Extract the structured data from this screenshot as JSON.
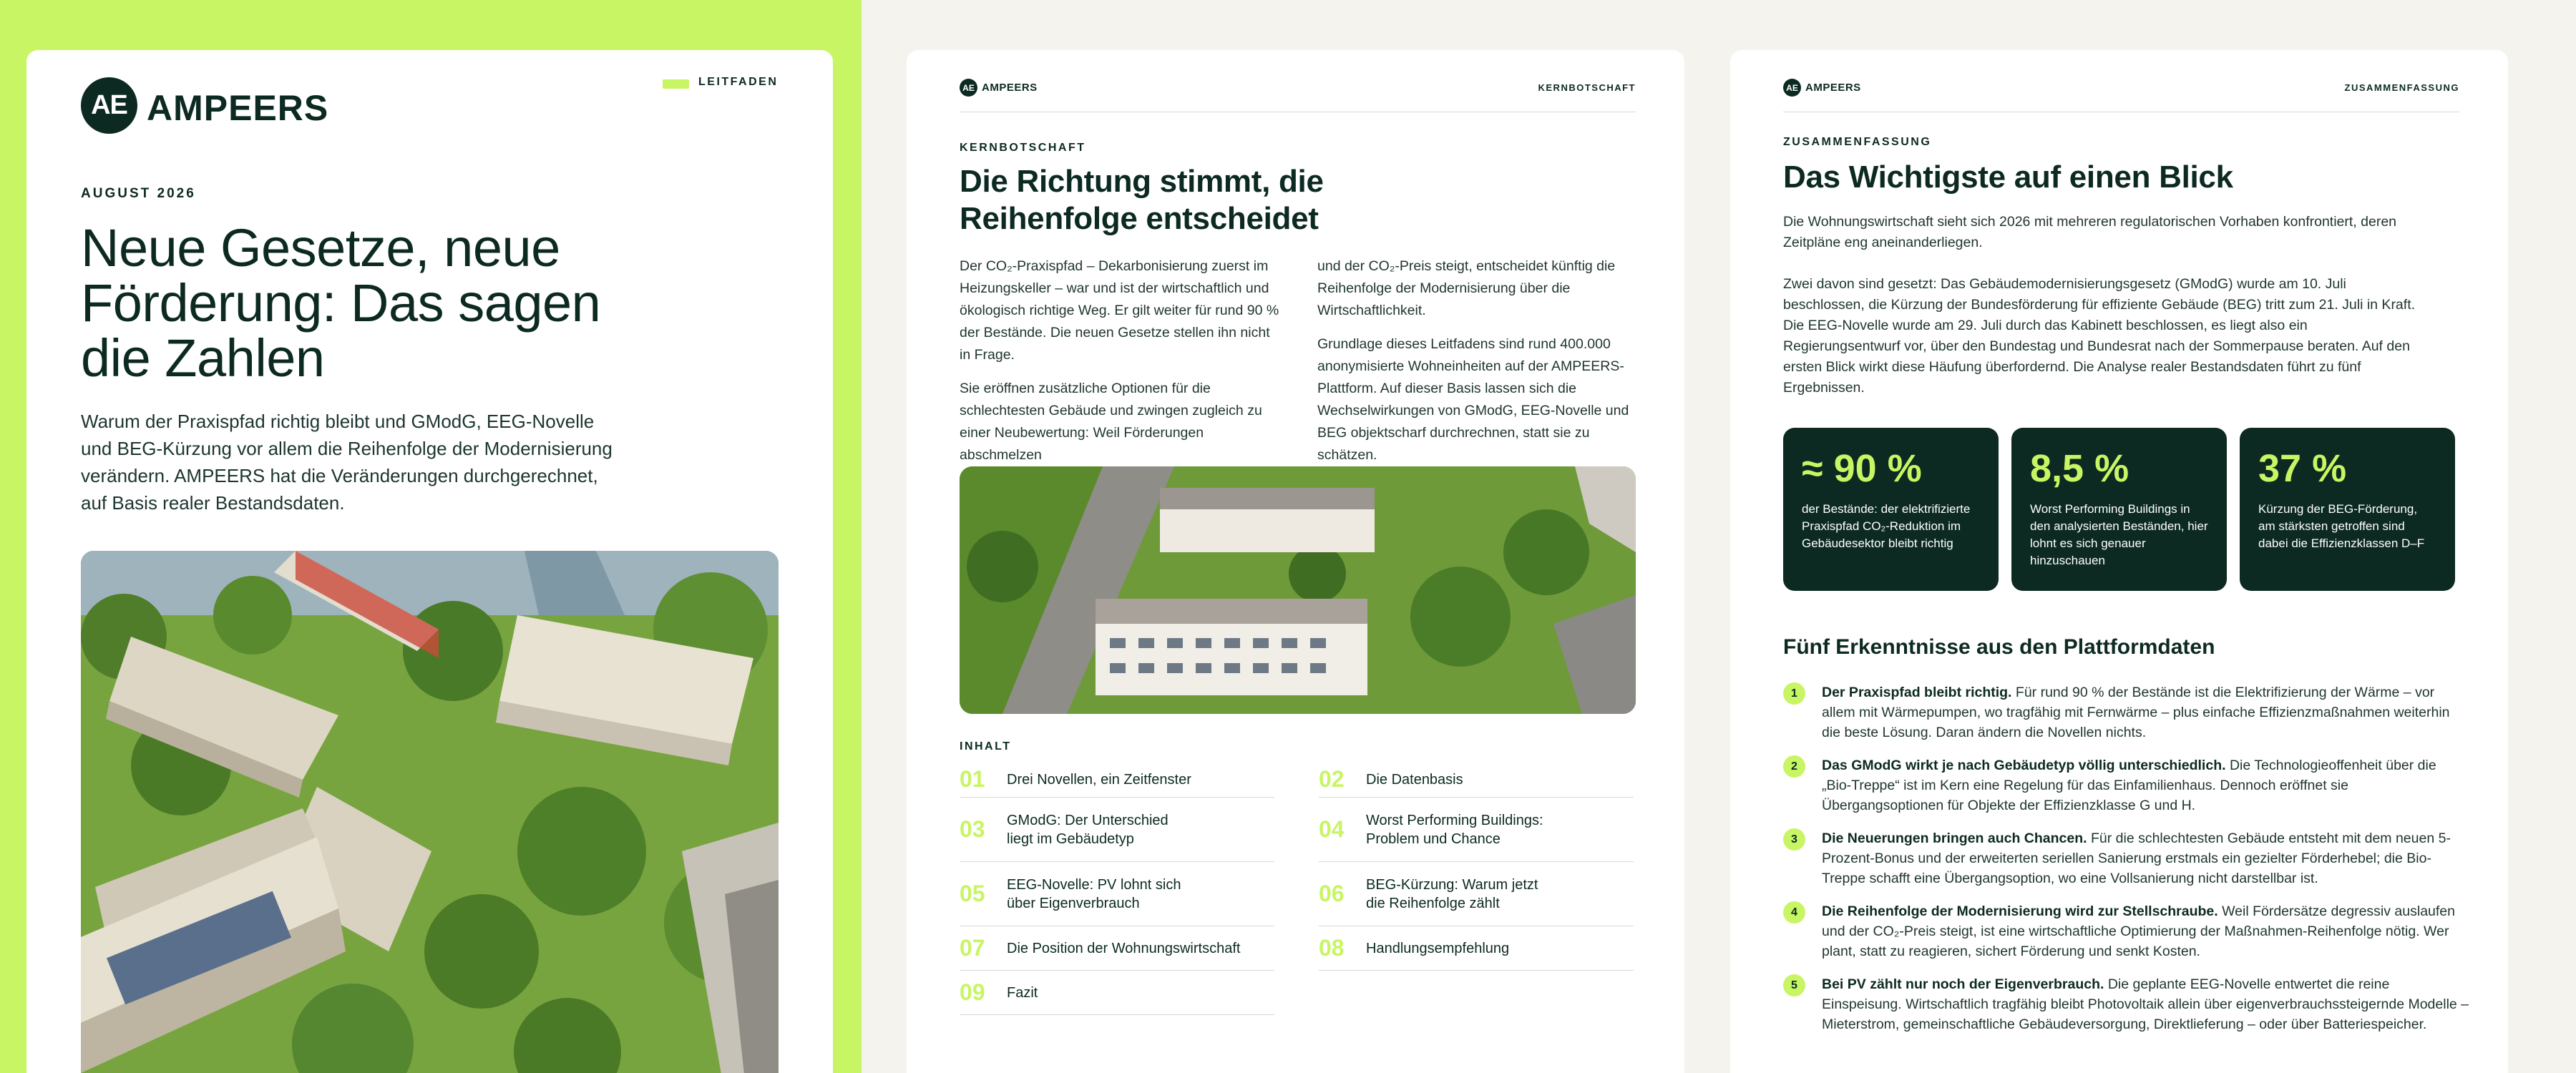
{
  "brand": {
    "mark": "AE",
    "name": "AMPEERS"
  },
  "colors": {
    "lime": "#c8f563",
    "dark_green": "#0c2a22",
    "page_bg": "#f4f3ee"
  },
  "cover": {
    "tag": "LEITFADEN",
    "date": "AUGUST 2026",
    "title": "Neue Gesetze, neue Förderung: Das sagen die Zahlen",
    "lead": "Warum der Praxispfad richtig bleibt und GModG, EEG-Novelle und BEG-Kürzung vor allem die Reihenfolge der Modernisierung verändern. AMPEERS hat die Veränderungen durchgerechnet, auf Basis realer Bestandsdaten.",
    "photo_icon": "aerial-residential-blocks-photo"
  },
  "page2": {
    "header_right": "KERNBOTSCHAFT",
    "eyebrow": "KERNBOTSCHAFT",
    "title": "Die Richtung stimmt, die Reihenfolge entscheidet",
    "col1_p1": "Der CO₂-Praxispfad – Dekarbonisierung zuerst im Heizungskeller – war und ist der wirtschaftlich und ökologisch richtige Weg. Er gilt weiter für rund 90 % der Bestände. Die neuen Gesetze stellen ihn nicht in Frage.",
    "col1_p2": "Sie eröffnen zusätzliche Optionen für die schlechtesten Gebäude und zwingen zugleich zu einer Neubewertung: Weil Förderungen abschmelzen",
    "col2_p1": "und der CO₂-Preis steigt, entscheidet künftig die Reihenfolge der Modernisierung über die Wirtschaftlichkeit.",
    "col2_p2": "Grundlage dieses Leitfadens sind rund 400.000 anonymisierte Wohneinheiten auf der AMPEERS-Plattform. Auf dieser Basis lassen sich die Wechselwirkungen von GModG, EEG-Novelle und BEG objektscharf durchrechnen, statt sie zu schätzen.",
    "photo_icon": "aerial-apartment-buildings-photo",
    "toc_heading": "INHALT",
    "toc": [
      {
        "num": "01",
        "label": "Drei Novellen, ein Zeitfenster"
      },
      {
        "num": "02",
        "label": "Die Datenbasis"
      },
      {
        "num": "03",
        "label": "GModG: Der Unterschied liegt im Gebäudetyp"
      },
      {
        "num": "04",
        "label": "Worst Performing Buildings: Problem und Chance"
      },
      {
        "num": "05",
        "label": "EEG-Novelle: PV lohnt sich über Eigenverbrauch"
      },
      {
        "num": "06",
        "label": "BEG-Kürzung: Warum jetzt die Reihenfolge zählt"
      },
      {
        "num": "07",
        "label": "Die Position der Wohnungswirtschaft"
      },
      {
        "num": "08",
        "label": "Handlungsempfehlung"
      },
      {
        "num": "09",
        "label": "Fazit"
      }
    ]
  },
  "page3": {
    "header_right": "ZUSAMMENFASSUNG",
    "eyebrow": "ZUSAMMENFASSUNG",
    "title": "Das Wichtigste auf einen Blick",
    "intro": "Die Wohnungswirtschaft sieht sich 2026 mit mehreren regulatorischen Vorhaben konfrontiert, deren Zeitpläne eng aneinanderliegen.",
    "para2": "Zwei davon sind gesetzt: Das Gebäudemodernisierungsgesetz (GModG) wurde am 10. Juli beschlossen, die Kürzung der Bundesförderung für effiziente Gebäude (BEG) tritt zum 21. Juli in Kraft. Die EEG-Novelle wurde am 29. Juli durch das Kabinett beschlossen, es liegt also ein Regierungsentwurf vor, über den Bundestag und Bundesrat nach der Sommerpause beraten. Auf den ersten Blick wirkt diese Häufung überfordernd. Die Analyse realer Bestandsdaten führt zu fünf Ergebnissen.",
    "stats": [
      {
        "value": "≈ 90 %",
        "text": "der Bestände: der elektrifizierte Praxispfad CO₂-Reduktion im Gebäudesektor bleibt richtig"
      },
      {
        "value": "8,5 %",
        "text": "Worst Performing Buildings in den analysierten Beständen, hier lohnt es sich genauer hinzuschauen"
      },
      {
        "value": "37 %",
        "text": "Kürzung der BEG-Förderung, am stärksten getroffen sind dabei die Effizienzklassen D–F"
      }
    ],
    "findings_heading": "Fünf Erkenntnisse aus den Plattformdaten",
    "findings": [
      {
        "num": "1",
        "bold": "Der Praxispfad bleibt richtig.",
        "text": " Für rund 90 % der Bestände ist die Elektrifizierung der Wärme – vor allem mit Wärmepumpen, wo tragfähig mit Fernwärme – plus einfache Effizienzmaßnahmen weiterhin die beste Lösung. Daran ändern die Novellen nichts."
      },
      {
        "num": "2",
        "bold": "Das GModG wirkt je nach Gebäudetyp völlig unterschiedlich.",
        "text": " Die Technologieoffenheit über die „Bio-Treppe“ ist im Kern eine Regelung für das Einfamilienhaus. Dennoch eröffnet sie Übergangsoptionen für Objekte der Effizienzklasse G und H."
      },
      {
        "num": "3",
        "bold": "Die Neuerungen bringen auch Chancen.",
        "text": " Für die schlechtesten Gebäude entsteht mit dem neuen 5-Prozent-Bonus und der erweiterten seriellen Sanierung erstmals ein gezielter Förderhebel; die Bio-Treppe schafft eine Übergangsoption, wo eine Vollsanierung nicht darstellbar ist."
      },
      {
        "num": "4",
        "bold": "Die Reihenfolge der Modernisierung wird zur Stellschraube.",
        "text": " Weil Fördersätze degressiv auslaufen und der CO₂-Preis steigt, ist eine wirtschaftliche Optimierung der Maßnahmen-Reihenfolge nötig. Wer plant, statt zu reagieren, sichert Förderung und senkt Kosten."
      },
      {
        "num": "5",
        "bold": "Bei PV zählt nur noch der Eigenverbrauch.",
        "text": " Die geplante EEG-Novelle entwertet die reine Einspeisung. Wirtschaftlich tragfähig bleibt Photovoltaik allein über eigenverbrauchssteigernde Modelle – Mieterstrom, gemeinschaftliche Gebäudeversorgung, Direktlieferung – oder über Batteriespeicher."
      }
    ]
  }
}
